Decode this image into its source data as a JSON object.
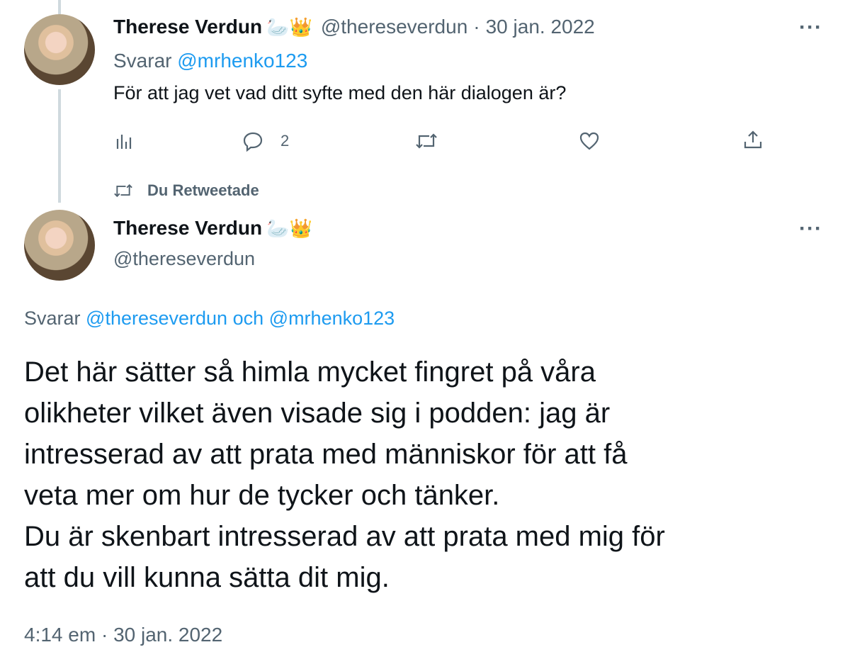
{
  "reply_tweet": {
    "author_name": "Therese Verdun",
    "badges": "🦢👑",
    "handle": "@thereseverdun",
    "separator": "·",
    "date": "30 jan. 2022",
    "replying_prefix": "Svarar",
    "replying_to": "@mrhenko123",
    "text": "För att jag vet vad ditt syfte med den här dialogen är?",
    "actions": {
      "analytics_icon": "analytics-icon",
      "reply_icon": "reply-icon",
      "reply_count": "2",
      "retweet_icon": "retweet-icon",
      "like_icon": "like-icon",
      "share_icon": "share-icon"
    },
    "more": "···"
  },
  "retweet_notice": {
    "icon": "retweet-icon",
    "label": "Du Retweetade"
  },
  "main_tweet": {
    "author_name": "Therese Verdun",
    "badges": "🦢👑",
    "handle": "@thereseverdun",
    "more": "···",
    "replying_prefix": "Svarar",
    "replying_to_1": "@thereseverdun",
    "replying_and": "och",
    "replying_to_2": "@mrhenko123",
    "text_lines": [
      "Det här sätter så himla mycket fingret på våra",
      "olikheter vilket även visade sig i podden: jag är",
      "intresserad av att prata med människor för att få",
      "veta mer om hur de tycker och tänker.",
      "Du är skenbart intresserad av att prata med mig för",
      "att du vill kunna sätta dit mig."
    ],
    "time": "4:14 em",
    "separator": "·",
    "date": "30 jan. 2022"
  },
  "colors": {
    "link": "#1d9bf0",
    "muted": "#536471",
    "text": "#0f1419"
  }
}
